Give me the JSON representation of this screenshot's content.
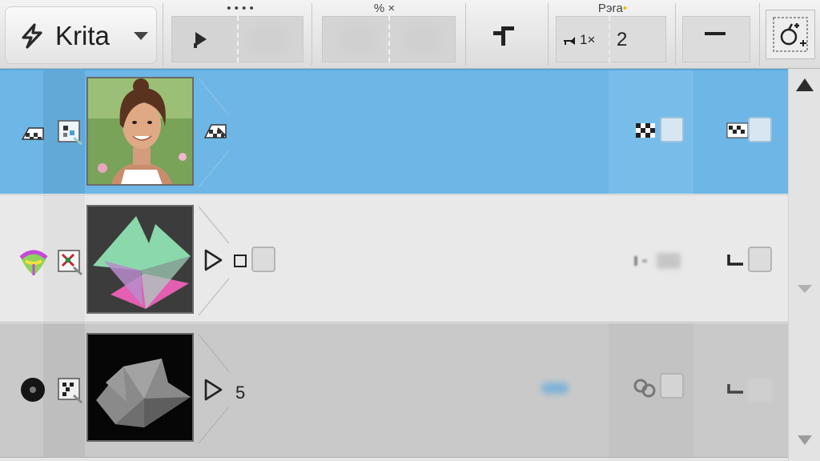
{
  "app": {
    "name": "Krita",
    "accent": "#6db6e6"
  },
  "toolbar": {
    "group1_caption": "• • • •",
    "group2_caption": "% ×",
    "group3_caption": "Pэra",
    "mult_label": "1×",
    "count_value": "2",
    "icons": [
      "lightning-bolt-icon",
      "chevron-down-icon",
      "play-step-icon",
      "corner-icon",
      "link-chain-icon",
      "minus-icon",
      "add-layer-gear-icon"
    ]
  },
  "layers": [
    {
      "kind": "photo",
      "selected": true,
      "label": "",
      "status_icons": [
        "checker-icon",
        "mask-icon",
        "paint-mask-icon",
        "checker-visibility-icon",
        "checker-lock-icon"
      ]
    },
    {
      "kind": "vector-3d",
      "selected": false,
      "label": "",
      "status_icons": [
        "color-bulb-icon",
        "transform-mask-icon",
        "play-icon",
        "small-square-icon",
        "sync-icon",
        "corner-lock-icon"
      ]
    },
    {
      "kind": "grayscale-3d",
      "selected": false,
      "label": "5",
      "status_icons": [
        "dark-circle-icon",
        "paint-mask-icon",
        "play-icon",
        "blue-dot-icon",
        "group-icon",
        "corner-lock-icon"
      ]
    }
  ],
  "scrollbar": {
    "icons": [
      "arrow-up-icon",
      "arrow-down-icon"
    ]
  }
}
